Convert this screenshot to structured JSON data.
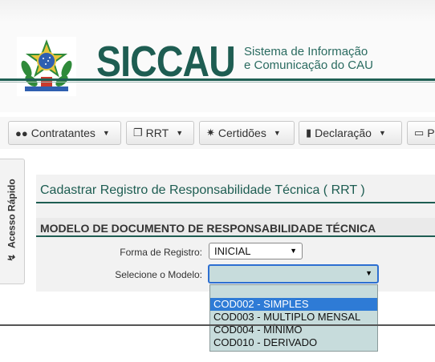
{
  "header": {
    "logo_text": "SICCAU",
    "subtitle_line1": "Sistema de Informação",
    "subtitle_line2": "e Comunicação do CAU",
    "emblem_icon": "brazil-coat-of-arms-icon"
  },
  "nav": {
    "items": [
      {
        "label": "Contratantes",
        "icon": "users-icon"
      },
      {
        "label": "RRT",
        "icon": "copy-icon"
      },
      {
        "label": "Certidões",
        "icon": "certificate-icon"
      },
      {
        "label": "Declaração",
        "icon": "book-icon"
      },
      {
        "label": "P",
        "icon": "print-icon"
      }
    ]
  },
  "sidebar": {
    "label": "Acesso Rápido",
    "icon": "bolt-icon"
  },
  "page": {
    "title": "Cadastrar Registro de Responsabilidade Técnica ( RRT )",
    "section_title": "MODELO DE DOCUMENTO DE RESPONSABILIDADE TÉCNICA"
  },
  "form": {
    "forma_label": "Forma de Registro:",
    "forma_value": "INICIAL",
    "modelo_label": "Selecione o Modelo:",
    "modelo_value": "",
    "modelo_options": [
      "COD002 - SIMPLES",
      "COD003 - MULTIPLO MENSAL",
      "COD004 - MÍNIMO",
      "COD010 - DERIVADO"
    ],
    "highlighted_option": "COD002 - SIMPLES"
  },
  "colors": {
    "brand": "#1e5d52",
    "highlight": "#2e7bd6",
    "dropdown_bg": "#c7dcdc"
  }
}
